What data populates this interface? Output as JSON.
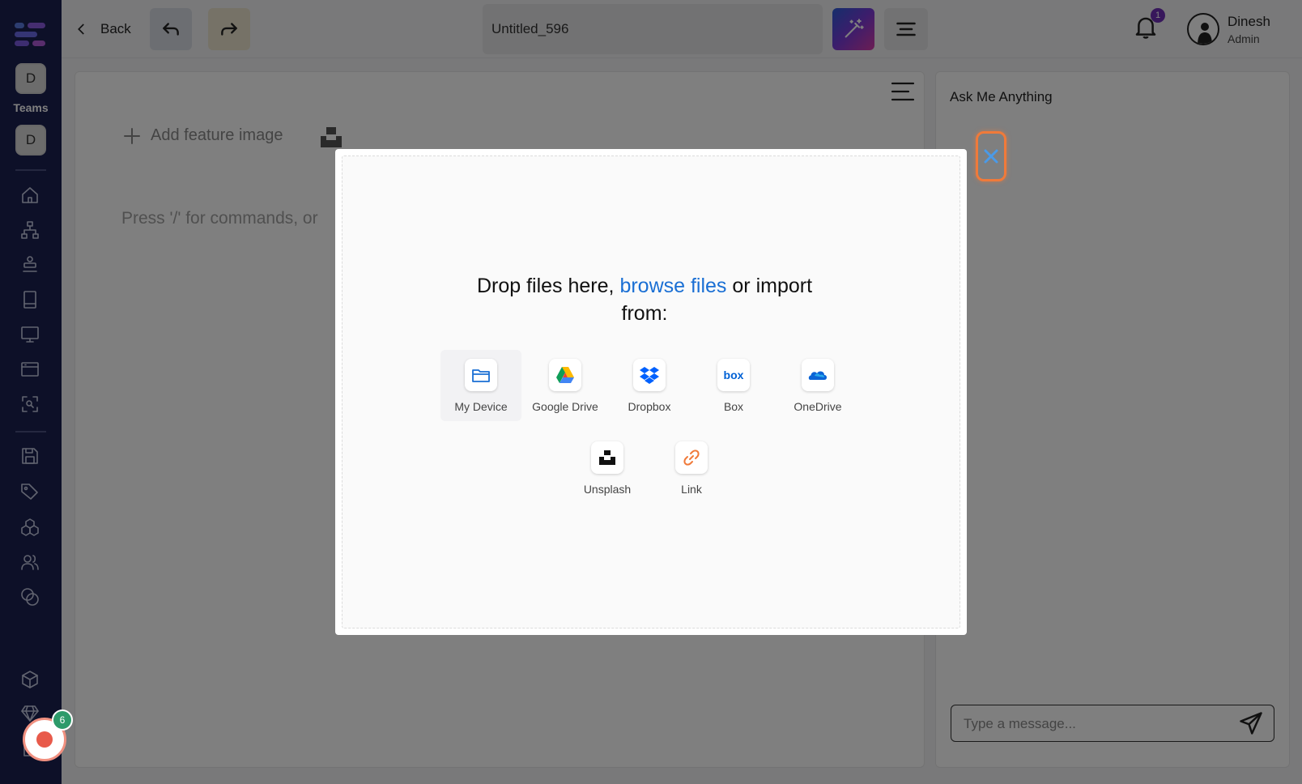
{
  "sidebar": {
    "workspace_initial": "D",
    "teams_label": "Teams",
    "team_initial": "D",
    "nav_icons": [
      "home-icon",
      "sitemap-icon",
      "stack-icon",
      "book-icon",
      "monitor-icon",
      "browser-icon",
      "scan-icon"
    ],
    "tool_icons": [
      "save-icon",
      "tag-icon",
      "cubes-icon",
      "users-icon",
      "coins-icon"
    ],
    "bottom_icons": [
      "package-icon",
      "gem-icon",
      "document-icon"
    ]
  },
  "topbar": {
    "back_label": "Back",
    "doc_title": "Untitled_596",
    "notification_count": "1",
    "user_name": "Dinesh",
    "user_role": "Admin"
  },
  "editor": {
    "add_feature_label": "Add feature image",
    "placeholder": "Press '/' for commands, or"
  },
  "ask_panel": {
    "title": "Ask Me Anything",
    "message_placeholder": "Type a message..."
  },
  "upload_modal": {
    "title_prefix": "Drop files here,",
    "browse_link": "browse files",
    "title_suffix": "or import from:",
    "sources": [
      {
        "label": "My Device",
        "icon": "folder-icon"
      },
      {
        "label": "Google Drive",
        "icon": "google-drive-icon"
      },
      {
        "label": "Dropbox",
        "icon": "dropbox-icon"
      },
      {
        "label": "Box",
        "icon": "box-icon"
      },
      {
        "label": "OneDrive",
        "icon": "onedrive-icon"
      },
      {
        "label": "Unsplash",
        "icon": "unsplash-icon"
      },
      {
        "label": "Link",
        "icon": "link-icon"
      }
    ]
  },
  "recorder": {
    "badge_count": "6"
  },
  "colors": {
    "sidebar_bg": "#1a2151",
    "link_blue": "#1a6fd4",
    "close_highlight": "#f07a3a",
    "notification_badge": "#6e2fb7",
    "recorder_badge": "#2d9a6a",
    "recorder_dot": "#e85a4a"
  }
}
